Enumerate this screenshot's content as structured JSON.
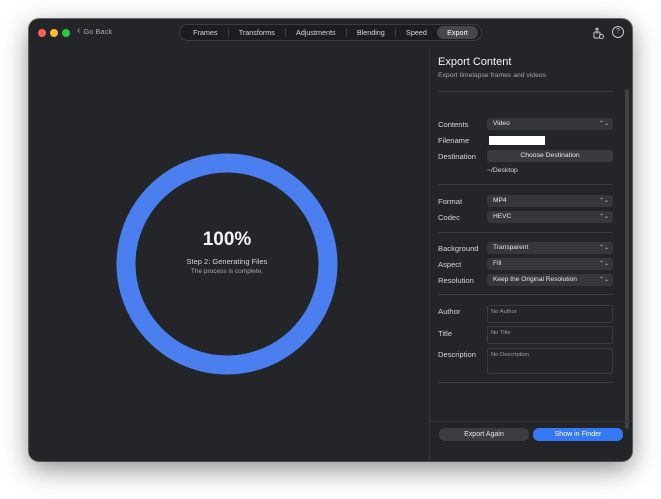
{
  "window": {
    "go_back": "Go Back",
    "tabs": [
      {
        "label": "Frames"
      },
      {
        "label": "Transforms"
      },
      {
        "label": "Adjustments"
      },
      {
        "label": "Blending"
      },
      {
        "label": "Speed"
      },
      {
        "label": "Export"
      }
    ],
    "active_tab": "Export",
    "toolbar_icons": [
      "share-export-icon",
      "help-icon"
    ]
  },
  "progress": {
    "percent": 1.0,
    "percent_label": "100%",
    "step": "Step 2: Generating Files",
    "message": "The process is complete.",
    "ring_color": "#4b7ff0"
  },
  "panel": {
    "title": "Export Content",
    "subtitle": "Export timelapse frames and videos",
    "contents": {
      "label": "Contents",
      "value": "Video"
    },
    "filename": {
      "label": "Filename",
      "value": ""
    },
    "destination": {
      "label": "Destination",
      "button": "Choose Destination",
      "path": "~/Desktop"
    },
    "format": {
      "label": "Format",
      "value": "MP4"
    },
    "codec": {
      "label": "Codec",
      "value": "HEVC"
    },
    "background": {
      "label": "Background",
      "value": "Transparent"
    },
    "aspect": {
      "label": "Aspect",
      "value": "Fill"
    },
    "resolution": {
      "label": "Resolution",
      "value": "Keep the Original Resolution"
    },
    "author": {
      "label": "Author",
      "placeholder": "No Author"
    },
    "title_field": {
      "label": "Title",
      "placeholder": "No Title"
    },
    "description": {
      "label": "Description",
      "placeholder": "No Description"
    }
  },
  "actions": {
    "export_again": "Export Again",
    "show_in_finder": "Show in Finder",
    "accent": "#3478f6"
  }
}
